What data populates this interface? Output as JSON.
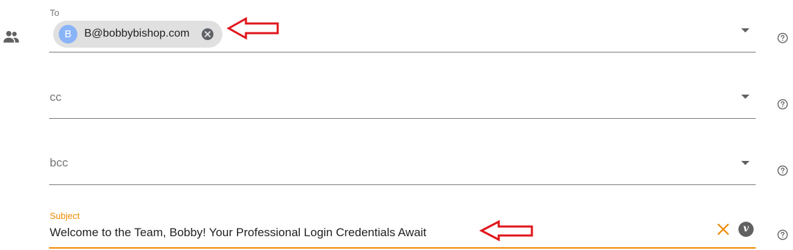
{
  "icons": {
    "people": "people-icon",
    "help": "help-circle-icon",
    "dropdown": "caret-down-icon",
    "chip_remove": "close-circle-icon",
    "clear": "close-icon",
    "variable": "variable-icon",
    "annotation": "red-arrow-icon"
  },
  "to": {
    "label": "To",
    "recipient": {
      "initial": "B",
      "email": "B@bobbybishop.com"
    }
  },
  "cc": {
    "placeholder": "cc"
  },
  "bcc": {
    "placeholder": "bcc"
  },
  "subject": {
    "label": "Subject",
    "value": "Welcome to the Team, Bobby! Your Professional Login Credentials Await",
    "variable_glyph": "v"
  },
  "colors": {
    "accent": "#f08a00",
    "chip_bg": "#e0e0e0",
    "avatar_bg": "#8ab4f8",
    "annotation_arrow": "#e0151b"
  }
}
